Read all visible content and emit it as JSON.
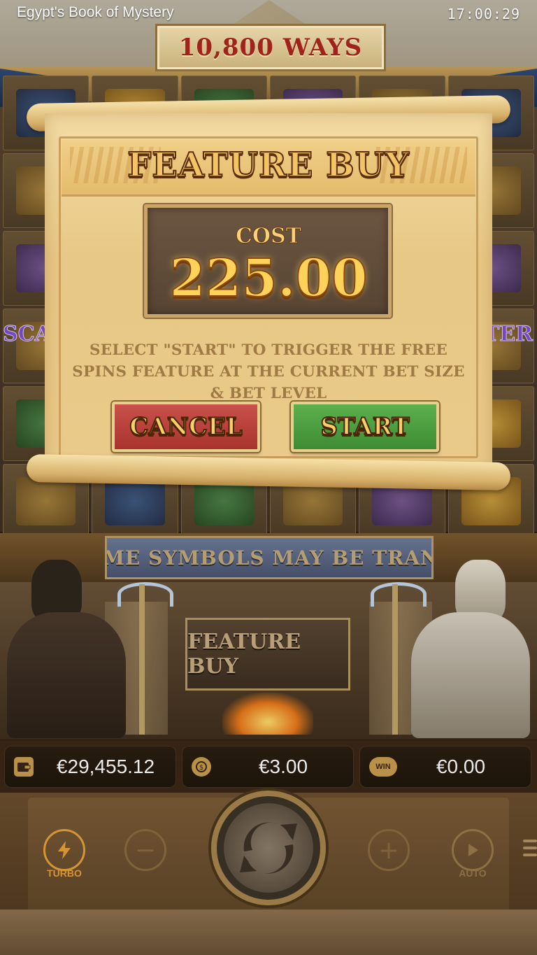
{
  "status_bar": {
    "app_title": "Egypt's Book of Mystery",
    "time": "17:00:29"
  },
  "game": {
    "ways_label": "10,800 WAYS",
    "scatter_left": "SCAT",
    "scatter_right": "TTER",
    "ticker_text": "SOME SYMBOLS MAY BE TRANSF",
    "feature_buy_plaque": "FEATURE BUY"
  },
  "dialog": {
    "title": "FEATURE BUY",
    "cost_label": "COST",
    "cost_value": "225.00",
    "description": "SELECT \"START\" TO TRIGGER THE FREE SPINS FEATURE AT THE CURRENT BET SIZE & BET LEVEL",
    "cancel_label": "CANCEL",
    "start_label": "START"
  },
  "info_bar": {
    "balance": "€29,455.12",
    "bet": "€3.00",
    "win_icon_label": "WIN",
    "win": "€0.00"
  },
  "controls": {
    "turbo_label": "TURBO",
    "auto_label": "AUTO",
    "minus_symbol": "−",
    "plus_symbol": "+"
  },
  "icons": {
    "wallet": "wallet-icon",
    "coins": "coins-icon",
    "win": "win-icon",
    "turbo": "lightning-icon",
    "spin": "spin-arrows-icon",
    "auto": "play-icon",
    "menu": "hamburger-menu-icon"
  },
  "colors": {
    "cancel": "#b8403a",
    "start": "#4e9f41",
    "gold_text": "#f6d17a"
  }
}
